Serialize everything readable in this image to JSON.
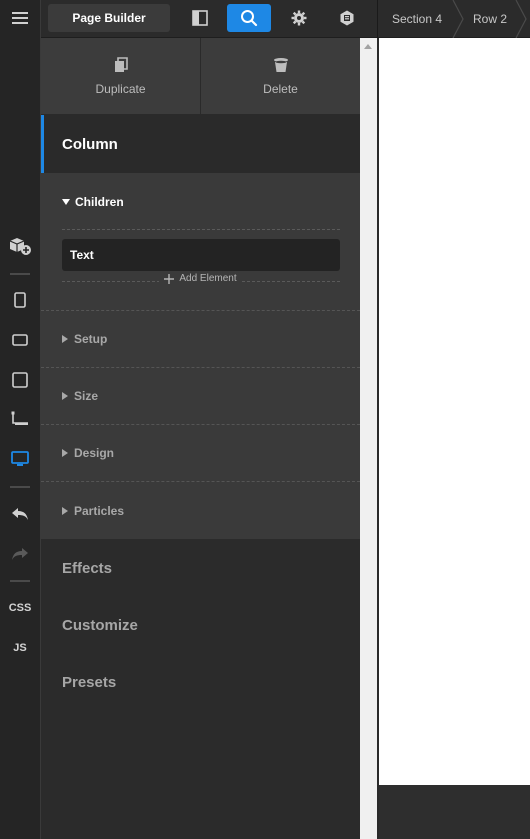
{
  "topbar": {
    "brand": "Page Builder",
    "breadcrumbs": [
      "Section 4",
      "Row 2"
    ]
  },
  "actions": {
    "duplicate": "Duplicate",
    "delete": "Delete"
  },
  "panel": {
    "title": "Column",
    "children_title": "Children",
    "children": [
      "Text"
    ],
    "add_element": "Add Element",
    "sections": [
      "Setup",
      "Size",
      "Design",
      "Particles"
    ],
    "nav": [
      "Effects",
      "Customize",
      "Presets"
    ]
  },
  "rail": {
    "css": "CSS",
    "js": "JS"
  },
  "colors": {
    "accent": "#1e88e5",
    "panel": "#3a3a3a",
    "background": "#2b2b2b"
  }
}
